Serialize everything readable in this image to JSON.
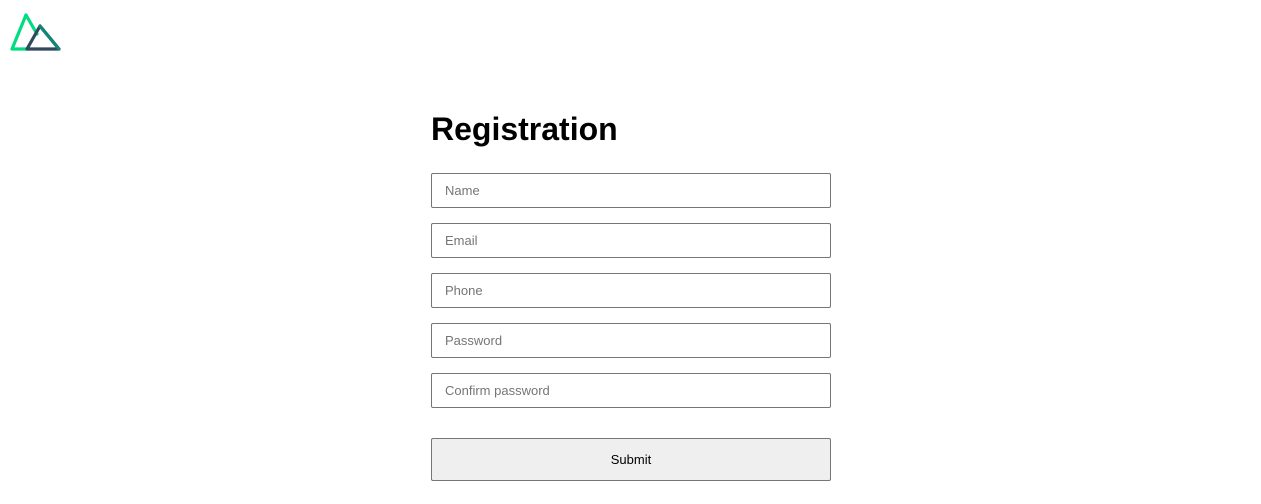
{
  "brand": {
    "logo_icon": "nuxt-mountain-logo-icon",
    "colors": {
      "green": "#00DC82",
      "dark": "#2F495E",
      "teal": "#108775"
    }
  },
  "form": {
    "title": "Registration",
    "fields": {
      "name": {
        "placeholder": "Name",
        "value": ""
      },
      "email": {
        "placeholder": "Email",
        "value": ""
      },
      "phone": {
        "placeholder": "Phone",
        "value": ""
      },
      "password": {
        "placeholder": "Password",
        "value": ""
      },
      "confirm_password": {
        "placeholder": "Confirm password",
        "value": ""
      }
    },
    "submit_label": "Submit"
  }
}
